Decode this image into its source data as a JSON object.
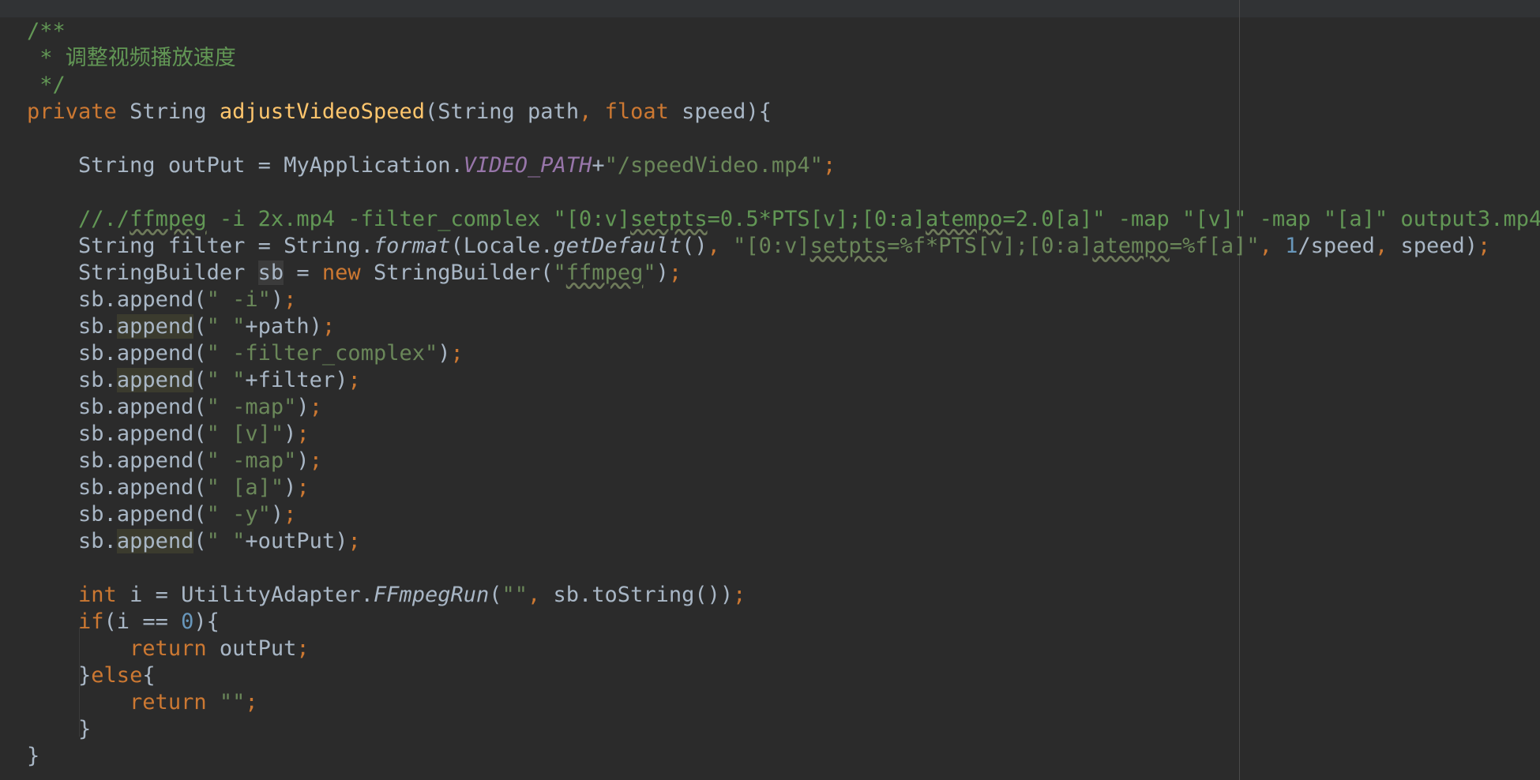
{
  "editor": {
    "doc_open": "/**",
    "doc_text": " * 调整视频播放速度",
    "doc_close": " */",
    "sig": {
      "modifier": "private",
      "return_type": "String",
      "name": "adjustVideoSpeed",
      "open": "(",
      "p1_type": "String",
      "p1_name": "path",
      "comma": ",",
      "p2_type": "float",
      "p2_name": "speed",
      "close": "){"
    },
    "l_output": {
      "type": "String",
      "name": "outPut",
      "eq": "=",
      "cls": "MyApplication.",
      "const": "VIDEO_PATH",
      "plus": "+",
      "str": "\"/speedVideo.mp4\"",
      "end": ";"
    },
    "cmt_ffmpeg_a": "//./",
    "cmt_ffmpeg_b": "ffmpeg",
    "cmt_ffmpeg_c": " -i 2x.mp4 -filter_complex \"[0:v]",
    "cmt_ffmpeg_d": "setpts",
    "cmt_ffmpeg_e": "=0.5*PTS[v];[0:a]",
    "cmt_ffmpeg_f": "atempo",
    "cmt_ffmpeg_g": "=2.0[a]\" -map \"[v]\" -map \"[a]\" output3.mp4",
    "l_filter": {
      "a": "String filter = String.",
      "fmt": "format",
      "b": "(Locale.",
      "gd": "getDefault",
      "c": "()",
      "comma1": ", ",
      "s1": "\"[0:v]",
      "s2": "setpts",
      "s3": "=%f*PTS[v];[0:a]",
      "s4": "atempo",
      "s5": "=%f[a]\"",
      "comma2": ", ",
      "one": "1",
      "d": "/speed",
      "comma3": ", ",
      "e": "speed)",
      "end": ";"
    },
    "l_sb": {
      "a": "StringBuilder ",
      "sb": "sb",
      "b": " = ",
      "new": "new",
      "c": " StringBuilder(",
      "q1": "\"",
      "ff": "ffmpeg",
      "q2": "\"",
      "d": ")",
      "end": ";"
    },
    "appends": [
      {
        "pre": "sb.",
        "m": "append",
        "open": "(",
        "s": "\" -i\"",
        "rest": ")",
        "end": ";",
        "hl": false
      },
      {
        "pre": "sb.",
        "m": "append",
        "open": "(",
        "s": "\" \"",
        "rest": "+path)",
        "end": ";",
        "hl": true
      },
      {
        "pre": "sb.",
        "m": "append",
        "open": "(",
        "s": "\" -filter_complex\"",
        "rest": ")",
        "end": ";",
        "hl": false
      },
      {
        "pre": "sb.",
        "m": "append",
        "open": "(",
        "s": "\" \"",
        "rest": "+filter)",
        "end": ";",
        "hl": true
      },
      {
        "pre": "sb.",
        "m": "append",
        "open": "(",
        "s": "\" -map\"",
        "rest": ")",
        "end": ";",
        "hl": false
      },
      {
        "pre": "sb.",
        "m": "append",
        "open": "(",
        "s": "\" [v]\"",
        "rest": ")",
        "end": ";",
        "hl": false
      },
      {
        "pre": "sb.",
        "m": "append",
        "open": "(",
        "s": "\" -map\"",
        "rest": ")",
        "end": ";",
        "hl": false
      },
      {
        "pre": "sb.",
        "m": "append",
        "open": "(",
        "s": "\" [a]\"",
        "rest": ")",
        "end": ";",
        "hl": false
      },
      {
        "pre": "sb.",
        "m": "append",
        "open": "(",
        "s": "\" -y\"",
        "rest": ")",
        "end": ";",
        "hl": false
      },
      {
        "pre": "sb.",
        "m": "append",
        "open": "(",
        "s": "\" \"",
        "rest": "+outPut)",
        "end": ";",
        "hl": true
      }
    ],
    "l_int": {
      "kw": "int",
      "a": " i = UtilityAdapter.",
      "fn": "FFmpegRun",
      "b": "(",
      "s": "\"\"",
      "comma": ", ",
      "c": "sb.toString())",
      "end": ";"
    },
    "l_if": {
      "kw": "if",
      "a": "(i == ",
      "num": "0",
      "b": "){"
    },
    "l_ret1": {
      "kw": "return",
      "a": " outPut",
      "end": ";"
    },
    "l_else": {
      "a": "}",
      "kw": "else",
      "b": "{"
    },
    "l_ret2": {
      "kw": "return",
      "sp": " ",
      "s": "\"\"",
      "end": ";"
    },
    "l_close_inner": "}",
    "l_close_outer": "}"
  }
}
